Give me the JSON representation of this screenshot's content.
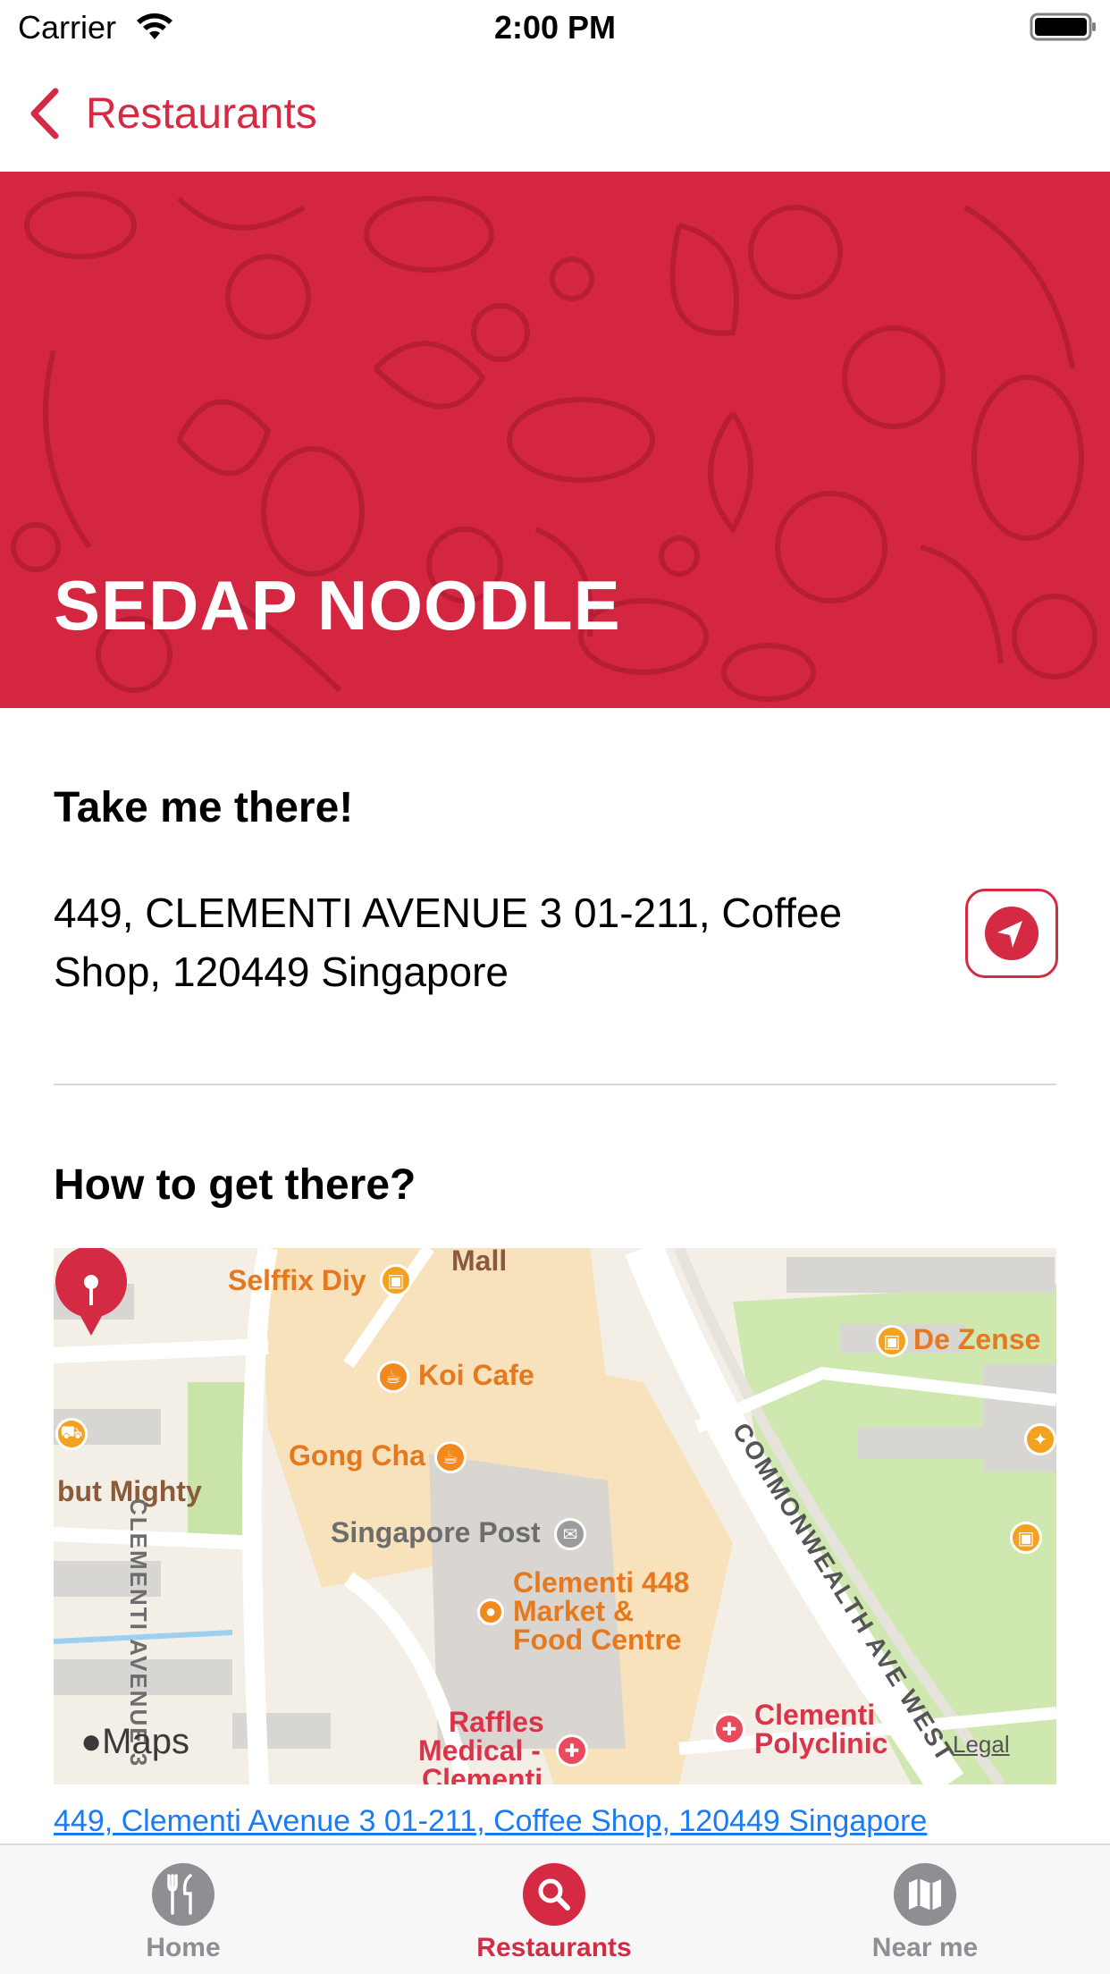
{
  "status_bar": {
    "carrier": "Carrier",
    "time": "2:00 PM"
  },
  "nav": {
    "back_label": "Restaurants"
  },
  "restaurant": {
    "name": "SEDAP NOODLE"
  },
  "directions": {
    "heading": "Take me there!",
    "address": "449, CLEMENTI AVENUE 3 01-211, Coffee Shop, 120449 Singapore"
  },
  "map_section": {
    "heading": "How to get there?",
    "labels": {
      "mall": "Mall",
      "selffix": "Selffix Diy",
      "de_zense": "De Zense",
      "koi_cafe": "Koi Cafe",
      "gong_cha": "Gong Cha",
      "but_mighty": "but Mighty",
      "singapore_post": "Singapore Post",
      "clementi_448_line1": "Clementi 448",
      "clementi_448_line2": "Market &",
      "clementi_448_line3": "Food Centre",
      "raffles_line1": "Raffles",
      "raffles_line2": "Medical -",
      "raffles_line3": "Clementi",
      "polyclinic_line1": "Clementi",
      "polyclinic_line2": "Polyclinic",
      "street_clementi": "CLEMENTI AVENUE 3",
      "street_commonwealth": "COMMONWEALTH AVE WEST"
    },
    "maps_logo": "Maps",
    "legal": "Legal",
    "address_link": "449, Clementi Avenue 3 01-211, Coffee Shop, 120449 Singapore"
  },
  "tabs": [
    {
      "label": "Home",
      "icon": "fork-knife-icon",
      "active": false
    },
    {
      "label": "Restaurants",
      "icon": "search-icon",
      "active": true
    },
    {
      "label": "Near me",
      "icon": "map-icon",
      "active": false
    }
  ],
  "colors": {
    "accent": "#d42a43",
    "hero_background": "#d52641",
    "link": "#1a7cf2",
    "tab_inactive": "#8e8e93"
  }
}
